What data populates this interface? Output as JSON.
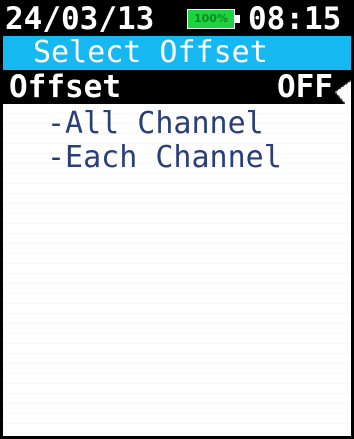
{
  "status": {
    "date": "24/03/13",
    "battery_label": "100%",
    "time": "08:15"
  },
  "title": "Select Offset",
  "offset_row": {
    "label": "Offset",
    "value": "OFF"
  },
  "menu": {
    "items": [
      {
        "label": "-All Channel"
      },
      {
        "label": "-Each Channel"
      }
    ]
  },
  "colors": {
    "title_bar": "#16b8f2",
    "battery": "#1fd23f",
    "menu_text": "#2a3f77"
  }
}
